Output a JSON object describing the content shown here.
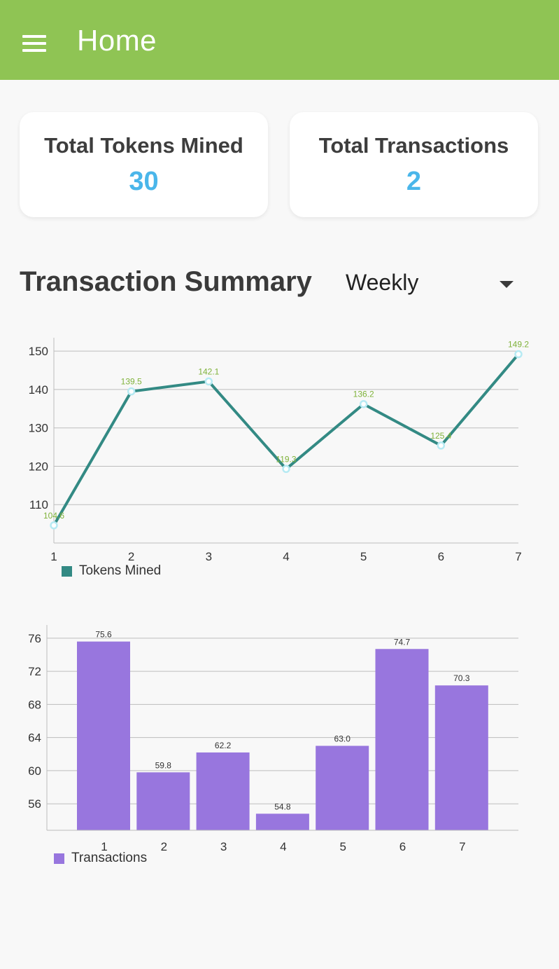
{
  "appbar": {
    "title": "Home",
    "color": "#8fc454"
  },
  "cards": [
    {
      "label": "Total Tokens Mined",
      "value": "30"
    },
    {
      "label": "Total Transactions",
      "value": "2"
    }
  ],
  "accent_value_color": "#4ab6ea",
  "summary": {
    "title": "Transaction Summary",
    "period": "Weekly"
  },
  "chart_data": [
    {
      "type": "line",
      "x": [
        1,
        2,
        3,
        4,
        5,
        6,
        7
      ],
      "values": [
        104.6,
        139.5,
        142.1,
        119.3,
        136.2,
        125.4,
        149.2
      ],
      "value_labels": [
        "104.6",
        "139.5",
        "142.1",
        "119.3",
        "136.2",
        "125.4",
        "149.2"
      ],
      "y_ticks": [
        "110",
        "120",
        "130",
        "140",
        "150"
      ],
      "x_ticks": [
        "1",
        "2",
        "3",
        "4",
        "5",
        "6",
        "7"
      ],
      "ylim": [
        100,
        153.5
      ],
      "grid": true,
      "legend_position": "bottom-left",
      "series": [
        {
          "name": "Tokens Mined",
          "color": "#338a84",
          "point_color": "#b6eaf3",
          "label_color": "#7fb23a"
        }
      ]
    },
    {
      "type": "bar",
      "categories": [
        "1",
        "2",
        "3",
        "4",
        "5",
        "6",
        "7"
      ],
      "values": [
        75.6,
        59.8,
        62.2,
        54.8,
        63.0,
        74.7,
        70.3
      ],
      "value_labels": [
        "75.6",
        "59.8",
        "62.2",
        "54.8",
        "63.0",
        "74.7",
        "70.3"
      ],
      "y_ticks": [
        "56",
        "60",
        "64",
        "68",
        "72",
        "76"
      ],
      "ylim": [
        52.8,
        77.6
      ],
      "grid": true,
      "legend_position": "bottom-left",
      "series": [
        {
          "name": "Transactions",
          "color": "#9876de"
        }
      ]
    }
  ]
}
